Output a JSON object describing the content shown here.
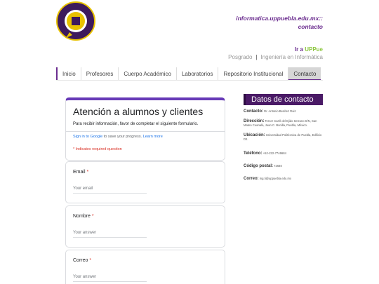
{
  "header": {
    "logo_alt": "UNIVERSIDAD POLITÉCNICA DE PUEBLA",
    "site_title_line1": "informatica.uppuebla.edu.mx::",
    "site_title_line2": "contacto",
    "ira_prefix": "Ir a",
    "ira_brand": "UPPue",
    "link_posgrado": "Posgrado",
    "link_sep": "|",
    "link_ingenieria": "Ingeniería en Informática"
  },
  "nav": {
    "items": [
      {
        "label": "Inicio"
      },
      {
        "label": "Profesores"
      },
      {
        "label": "Cuerpo Académico"
      },
      {
        "label": "Laboratorios"
      },
      {
        "label": "Repositorio Institucional"
      },
      {
        "label": "Contacto"
      }
    ],
    "active": "Contacto"
  },
  "form": {
    "title": "Atención a alumnos y clientes",
    "description": "Para recibir información, favor de completar el siguiente formulario.",
    "signin_link": "Sign in to Google",
    "signin_text": " to save your progress. ",
    "learn_more": "Learn more",
    "required_note": "* Indicates required question",
    "questions": [
      {
        "label": "Email",
        "star": "*",
        "placeholder": "Your email"
      },
      {
        "label": "Nombre",
        "star": "*",
        "placeholder": "Your answer"
      },
      {
        "label": "Correo",
        "star": "*",
        "placeholder": "Your answer"
      }
    ]
  },
  "sidebar": {
    "title": "Datos de contacto",
    "rows": [
      {
        "label": "Contacto:",
        "value": " Dr. Antonio Benítez Ruiz"
      },
      {
        "label": "Dirección:",
        "value": " Tercer Carril del Ejido Serrano S/N, San Mateo Cuanalá, Juan C. Bonilla, Puebla, México."
      },
      {
        "label": "Ubicación:",
        "value": " Universidad Politécnica de Puebla, Edificio D2."
      },
      {
        "label": "Teléfono:",
        "value": " +52-222-7746684"
      },
      {
        "label": "Código postal:",
        "value": " 72640"
      },
      {
        "label": "Correo:",
        "value": " ing.ti@uppuebla.edu.mx"
      }
    ]
  },
  "colors": {
    "brand_purple": "#6b2d8f",
    "accent_green": "#8cc63f",
    "form_accent": "#673ab7",
    "required_red": "#d93025"
  }
}
